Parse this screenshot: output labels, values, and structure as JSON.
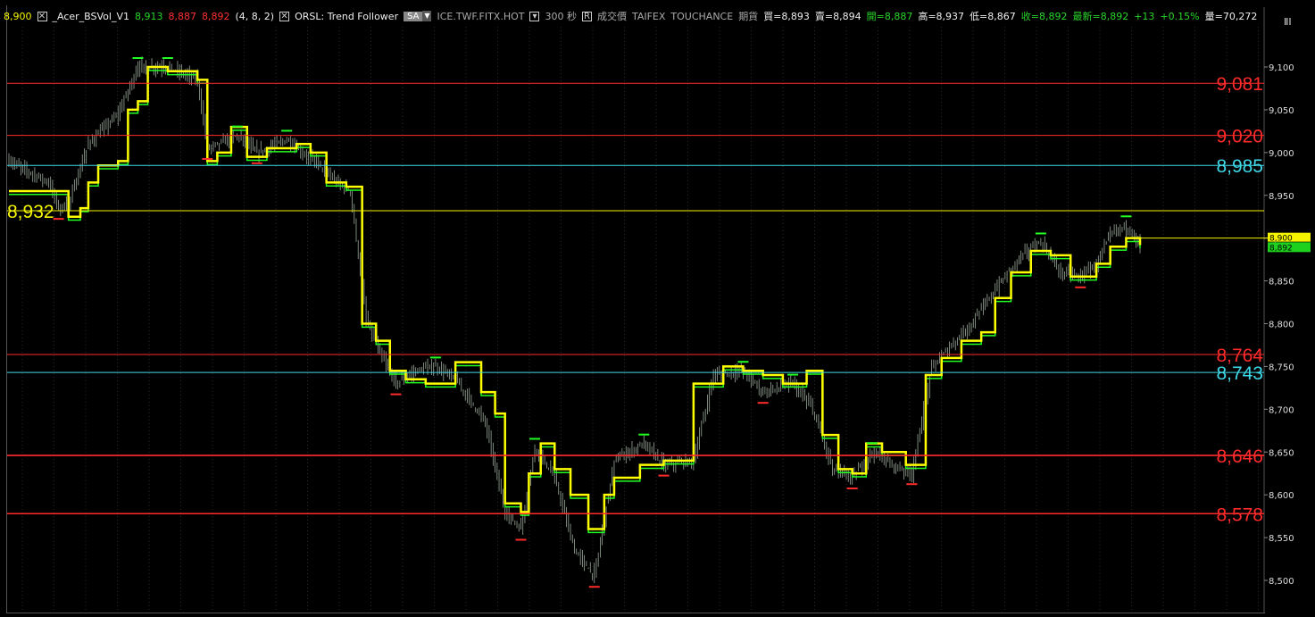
{
  "header": {
    "first_price": "8,900",
    "indicator_1": "_Acer_BSVol_V1",
    "ind1_v1": "8,913",
    "ind1_v2": "8,887",
    "ind1_v3": "8,892",
    "ind1_params": "(4,  8,  2)",
    "indicator_2": "ORSL: Trend Follower",
    "sa_label": "SA",
    "symbol": "ICE.TWF.FITX.HOT",
    "period": "300 秒",
    "price_type": "成交價",
    "exchange": "TAIFEX",
    "source": "TOUCHANCE",
    "product": "期貨",
    "bid": "買=8,893",
    "ask": "賣=8,894",
    "open": "開=8,887",
    "high": "高=8,937",
    "low": "低=8,867",
    "close": "收=8,892",
    "last": "最新=8,892",
    "change": "+13",
    "change_pct": "+0.15%",
    "volume": "量=70,272"
  },
  "side_icon": "ⅡⅠ",
  "colors": {
    "background": "#000000",
    "candle": "#9aa89a",
    "yellow_line": "#ffff00",
    "green_line": "#22ff22",
    "red_level": "#ff2a2a",
    "cyan_level": "#3fd8e8",
    "yellow_level": "#f5f500",
    "grid": "#2a2a2a"
  },
  "chart_data": {
    "type": "line",
    "ylim": [
      8490,
      9150
    ],
    "y_ticks": [
      "9,100",
      "9,050",
      "9,000",
      "8,950",
      "8,900",
      "8,850",
      "8,800",
      "8,750",
      "8,700",
      "8,650",
      "8,600",
      "8,550",
      "8,500"
    ],
    "y_tick_values": [
      9100,
      9050,
      9000,
      8950,
      8900,
      8850,
      8800,
      8750,
      8700,
      8650,
      8600,
      8550,
      8500
    ],
    "bar_count": 320,
    "grid": true,
    "horizontal_levels": [
      {
        "value": 9081,
        "label": "9,081",
        "color": "#ff2a2a",
        "label_side": "right"
      },
      {
        "value": 9020,
        "label": "9,020",
        "color": "#ff2a2a",
        "label_side": "right"
      },
      {
        "value": 8985,
        "label": "8,985",
        "color": "#3fd8e8",
        "label_side": "right"
      },
      {
        "value": 8932,
        "label": "8,932",
        "color": "#f5f500",
        "label_side": "left"
      },
      {
        "value": 8764,
        "label": "8,764",
        "color": "#ff2a2a",
        "label_side": "right"
      },
      {
        "value": 8743,
        "label": "8,743",
        "color": "#3fd8e8",
        "label_side": "right"
      },
      {
        "value": 8646,
        "label": "8,646",
        "color": "#ff2a2a",
        "label_side": "right"
      },
      {
        "value": 8578,
        "label": "8,578",
        "color": "#ff2a2a",
        "label_side": "right"
      }
    ],
    "price_path": [
      [
        0,
        8990
      ],
      [
        12,
        8975
      ],
      [
        20,
        8965
      ],
      [
        25,
        8935
      ],
      [
        30,
        8940
      ],
      [
        40,
        9010
      ],
      [
        55,
        9045
      ],
      [
        65,
        9100
      ],
      [
        80,
        9100
      ],
      [
        95,
        9085
      ],
      [
        100,
        9005
      ],
      [
        115,
        9020
      ],
      [
        125,
        9000
      ],
      [
        140,
        9015
      ],
      [
        150,
        8995
      ],
      [
        155,
        8990
      ],
      [
        165,
        8965
      ],
      [
        172,
        8955
      ],
      [
        180,
        8805
      ],
      [
        187,
        8765
      ],
      [
        195,
        8730
      ],
      [
        205,
        8745
      ],
      [
        215,
        8750
      ],
      [
        225,
        8735
      ],
      [
        240,
        8685
      ],
      [
        250,
        8580
      ],
      [
        258,
        8560
      ],
      [
        265,
        8655
      ],
      [
        275,
        8620
      ],
      [
        285,
        8535
      ],
      [
        295,
        8505
      ],
      [
        305,
        8640
      ],
      [
        320,
        8660
      ],
      [
        330,
        8635
      ],
      [
        345,
        8640
      ],
      [
        355,
        8740
      ],
      [
        370,
        8745
      ],
      [
        380,
        8720
      ],
      [
        395,
        8730
      ],
      [
        405,
        8700
      ],
      [
        415,
        8630
      ],
      [
        425,
        8620
      ],
      [
        435,
        8650
      ],
      [
        445,
        8635
      ],
      [
        455,
        8625
      ],
      [
        465,
        8750
      ],
      [
        475,
        8775
      ],
      [
        485,
        8800
      ],
      [
        497,
        8840
      ],
      [
        510,
        8880
      ],
      [
        520,
        8895
      ],
      [
        530,
        8860
      ],
      [
        540,
        8855
      ],
      [
        548,
        8870
      ],
      [
        555,
        8905
      ],
      [
        563,
        8915
      ],
      [
        570,
        8892
      ]
    ],
    "yellow_steps": [
      [
        0,
        8955
      ],
      [
        25,
        8955
      ],
      [
        30,
        8925
      ],
      [
        36,
        8935
      ],
      [
        40,
        8965
      ],
      [
        45,
        8985
      ],
      [
        55,
        8990
      ],
      [
        60,
        9050
      ],
      [
        65,
        9060
      ],
      [
        70,
        9100
      ],
      [
        80,
        9095
      ],
      [
        95,
        9085
      ],
      [
        100,
        8990
      ],
      [
        105,
        9000
      ],
      [
        112,
        9030
      ],
      [
        120,
        8995
      ],
      [
        130,
        9005
      ],
      [
        145,
        9010
      ],
      [
        152,
        9000
      ],
      [
        160,
        8965
      ],
      [
        170,
        8960
      ],
      [
        178,
        8800
      ],
      [
        185,
        8780
      ],
      [
        192,
        8745
      ],
      [
        200,
        8735
      ],
      [
        210,
        8730
      ],
      [
        225,
        8755
      ],
      [
        238,
        8720
      ],
      [
        245,
        8695
      ],
      [
        250,
        8590
      ],
      [
        258,
        8580
      ],
      [
        262,
        8625
      ],
      [
        268,
        8660
      ],
      [
        275,
        8630
      ],
      [
        283,
        8600
      ],
      [
        292,
        8560
      ],
      [
        300,
        8600
      ],
      [
        305,
        8620
      ],
      [
        318,
        8635
      ],
      [
        330,
        8640
      ],
      [
        338,
        8640
      ],
      [
        345,
        8730
      ],
      [
        360,
        8750
      ],
      [
        370,
        8745
      ],
      [
        380,
        8740
      ],
      [
        390,
        8730
      ],
      [
        402,
        8745
      ],
      [
        410,
        8670
      ],
      [
        418,
        8630
      ],
      [
        425,
        8625
      ],
      [
        432,
        8660
      ],
      [
        440,
        8650
      ],
      [
        452,
        8635
      ],
      [
        462,
        8740
      ],
      [
        470,
        8760
      ],
      [
        480,
        8780
      ],
      [
        490,
        8790
      ],
      [
        497,
        8830
      ],
      [
        505,
        8860
      ],
      [
        515,
        8885
      ],
      [
        525,
        8880
      ],
      [
        535,
        8855
      ],
      [
        548,
        8870
      ],
      [
        555,
        8890
      ],
      [
        563,
        8900
      ],
      [
        570,
        8892
      ]
    ]
  }
}
